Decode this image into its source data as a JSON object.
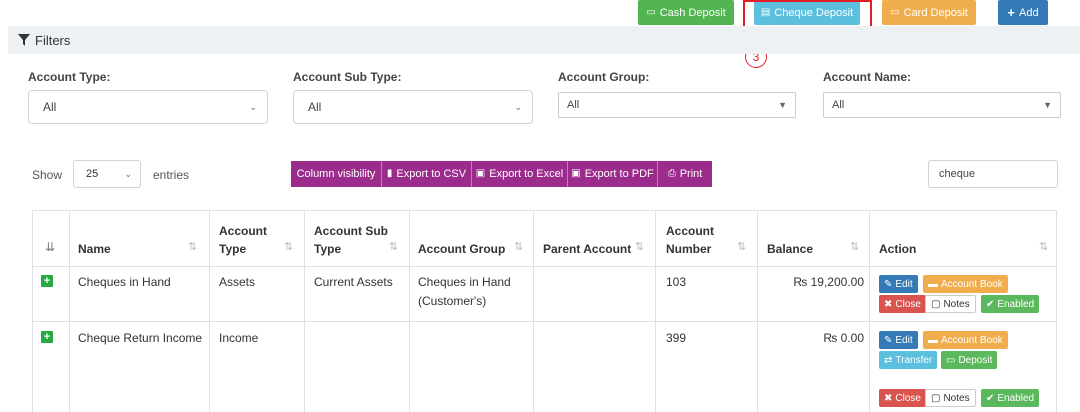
{
  "top_buttons": {
    "cash_deposit": "Cash Deposit",
    "cheque_deposit": "Cheque Deposit",
    "card_deposit": "Card Deposit",
    "add": "Add"
  },
  "annotation": {
    "step": "3"
  },
  "filters": {
    "title": "Filters",
    "account_type": {
      "label": "Account Type:",
      "value": "All"
    },
    "account_sub_type": {
      "label": "Account Sub Type:",
      "value": "All"
    },
    "account_group": {
      "label": "Account Group:",
      "value": "All"
    },
    "account_name": {
      "label": "Account Name:",
      "value": "All"
    }
  },
  "table_controls": {
    "show_label": "Show",
    "entries_value": "25",
    "entries_label": "entries",
    "export_buttons": [
      "Column visibility",
      "Export to CSV",
      "Export to Excel",
      "Export to PDF",
      "Print"
    ],
    "search_value": "cheque"
  },
  "table": {
    "headers": {
      "name": "Name",
      "account_type_1": "Account",
      "account_type_2": "Type",
      "account_sub_type_1": "Account Sub",
      "account_sub_type_2": "Type",
      "account_group": "Account Group",
      "parent_account": "Parent Account",
      "account_number_1": "Account",
      "account_number_2": "Number",
      "balance": "Balance",
      "action": "Action"
    },
    "rows": [
      {
        "name": "Cheques in Hand",
        "account_type": "Assets",
        "account_sub_type": "Current Assets",
        "account_group_1": "Cheques in Hand",
        "account_group_2": "(Customer's)",
        "parent_account": "",
        "account_number": "103",
        "balance": "₨ 19,200.00"
      },
      {
        "name": "Cheque Return Income",
        "account_type": "Income",
        "account_sub_type": "",
        "account_group_1": "",
        "account_group_2": "",
        "parent_account": "",
        "account_number": "399",
        "balance": "₨ 0.00"
      }
    ],
    "actions": {
      "edit": "Edit",
      "account_book": "Account Book",
      "close": "Close",
      "notes": "Notes",
      "enabled": "Enabled",
      "transfer": "Transfer",
      "deposit": "Deposit"
    }
  },
  "colors": {
    "cash_deposit": "#52b552",
    "cheque_deposit": "#5bc0de",
    "card_deposit": "#f0ad4e",
    "add": "#337ab7",
    "export": "#9b2c8c",
    "annotation": "#e31e24",
    "close": "#d9534f",
    "enabled": "#5cb85c"
  }
}
